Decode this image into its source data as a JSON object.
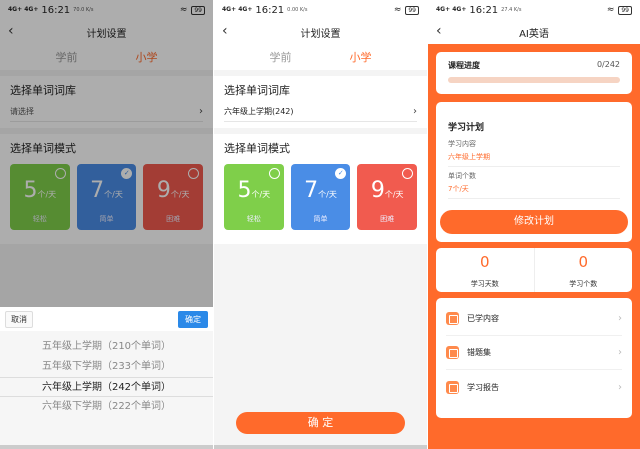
{
  "status": {
    "signal_left": "4G+ 4G+",
    "p1": {
      "time": "16:21",
      "speed": "70.0 K/s",
      "battery": "99"
    },
    "p2": {
      "time": "16:21",
      "speed": "0.00 K/s",
      "battery": "99"
    },
    "p3": {
      "time": "16:21",
      "speed": "27.4 K/s",
      "battery": "99"
    }
  },
  "plan": {
    "nav_title": "计划设置",
    "back": "‹",
    "tabs": [
      "学前",
      "小学"
    ],
    "lib_title": "选择单词词库",
    "lib_placeholder": "请选择",
    "lib_value": "六年级上学期(242)",
    "mode_title": "选择单词模式",
    "modes": [
      {
        "num": "5",
        "unit": "个/天",
        "label": "轻松",
        "color": "#7fcf4a"
      },
      {
        "num": "7",
        "unit": "个/天",
        "label": "简单",
        "color": "#4a8de6"
      },
      {
        "num": "9",
        "unit": "个/天",
        "label": "困难",
        "color": "#f15b4f"
      }
    ],
    "confirm": "确 定"
  },
  "picker": {
    "cancel": "取消",
    "ok": "确定",
    "options": [
      "五年级上学期（210个单词）",
      "五年级下学期（233个单词）",
      "六年级上学期（242个单词）",
      "六年级下学期（222个单词）"
    ],
    "selected_index": 2
  },
  "ai": {
    "nav_title": "AI英语",
    "progress_label": "课程进度",
    "progress_value": "0/242",
    "progress_fraction": 0,
    "plan_title": "学习计划",
    "content_label": "学习内容",
    "content_value": "六年级上学期",
    "count_label": "单词个数",
    "count_value": "7个/天",
    "modify_button": "修改计划",
    "days_value": "0",
    "days_label": "学习天数",
    "words_value": "0",
    "words_label": "学习个数",
    "menu": [
      {
        "label": "已学内容",
        "icon": "book-icon"
      },
      {
        "label": "错题集",
        "icon": "wrong-book-icon"
      },
      {
        "label": "学习报告",
        "icon": "report-icon"
      }
    ]
  }
}
